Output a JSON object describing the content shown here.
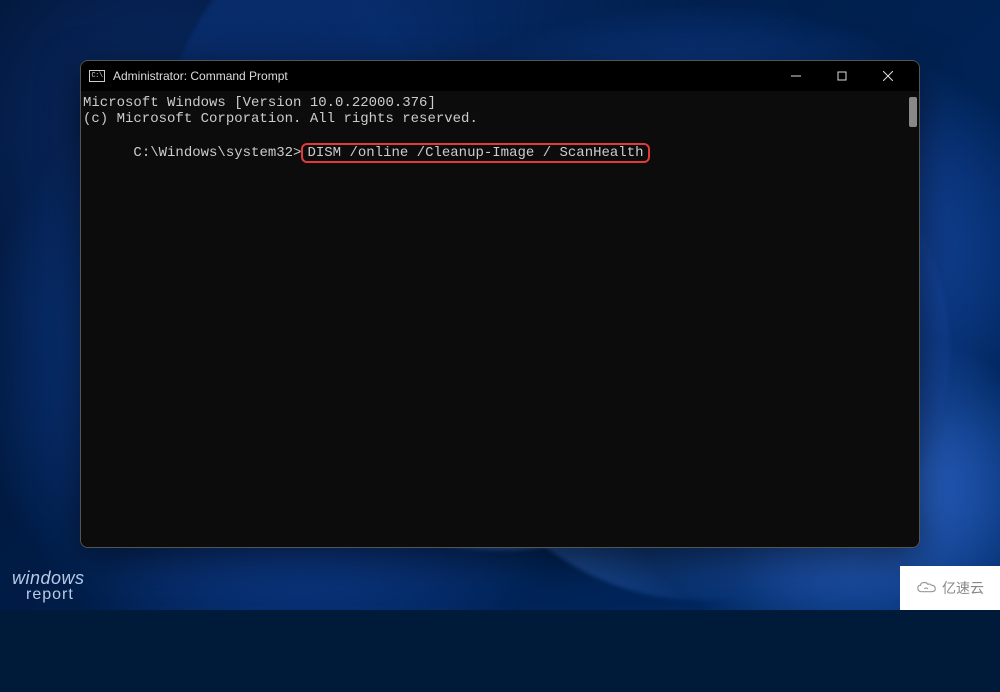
{
  "window": {
    "title": "Administrator: Command Prompt",
    "icon_label": "cmd-icon",
    "icon_text": "C:\\"
  },
  "controls": {
    "minimize": "minimize-button",
    "maximize": "maximize-button",
    "close": "close-button"
  },
  "terminal": {
    "line1": "Microsoft Windows [Version 10.0.22000.376]",
    "line2": "(c) Microsoft Corporation. All rights reserved.",
    "blank": "",
    "prompt": "C:\\Windows\\system32>",
    "command": "DISM /online /Cleanup-Image / ScanHealth"
  },
  "watermarks": {
    "wr_line1": "windows",
    "wr_line2": "report",
    "yisu": "亿速云"
  }
}
